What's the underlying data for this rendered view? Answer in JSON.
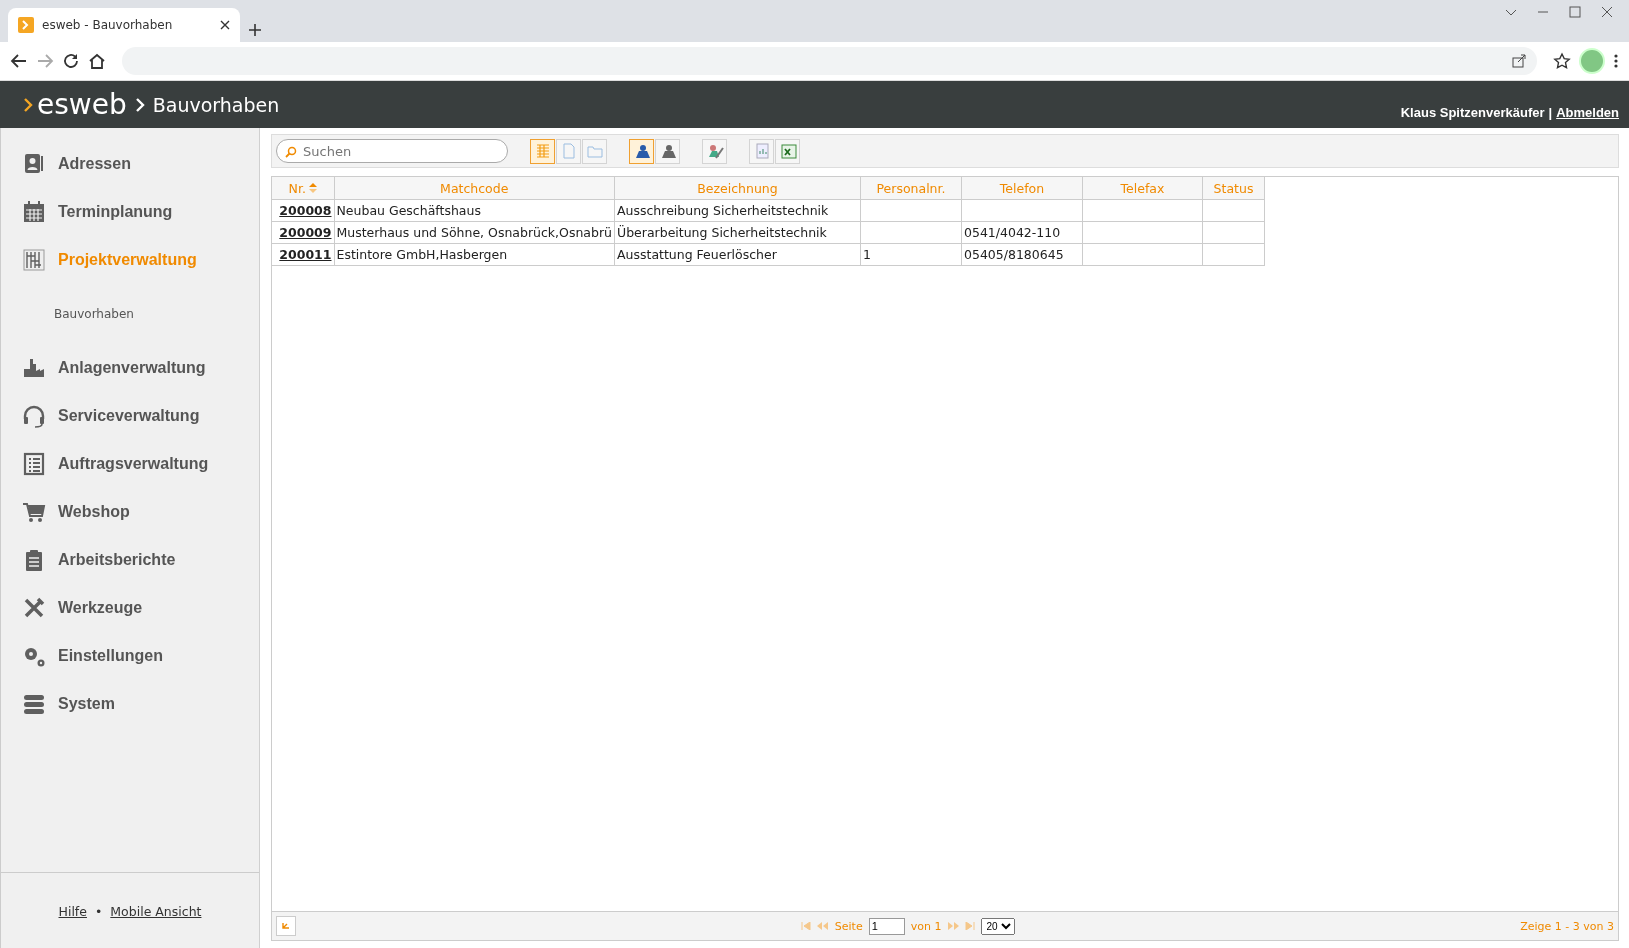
{
  "browser": {
    "tab_title": "esweb - Bauvorhaben"
  },
  "header": {
    "logo": "esweb",
    "breadcrumb": "Bauvorhaben",
    "user": "Klaus Spitzenverkäufer",
    "separator": "|",
    "logout": "Abmelden"
  },
  "sidebar": {
    "items": [
      {
        "label": "Adressen",
        "selected": false
      },
      {
        "label": "Terminplanung",
        "selected": false
      },
      {
        "label": "Projektverwaltung",
        "selected": true,
        "children": [
          {
            "label": "Bauvorhaben",
            "selected": false
          }
        ]
      },
      {
        "label": "Anlagenverwaltung",
        "selected": false
      },
      {
        "label": "Serviceverwaltung",
        "selected": false
      },
      {
        "label": "Auftragsverwaltung",
        "selected": false
      },
      {
        "label": "Webshop",
        "selected": false
      },
      {
        "label": "Arbeitsberichte",
        "selected": false
      },
      {
        "label": "Werkzeuge",
        "selected": false
      },
      {
        "label": "Einstellungen",
        "selected": false
      },
      {
        "label": "System",
        "selected": false
      }
    ],
    "footer_links": [
      "Hilfe",
      "Mobile Ansicht"
    ],
    "footer_separator": "•"
  },
  "toolbar": {
    "search": {
      "placeholder": "Suchen"
    },
    "groups": [
      [
        {
          "selected": true
        },
        {
          "selected": false
        },
        {
          "selected": false
        }
      ],
      [
        {
          "selected": true
        },
        {
          "selected": false
        }
      ],
      [
        {
          "selected": false
        }
      ],
      [
        {
          "selected": false
        },
        {
          "selected": false
        }
      ]
    ]
  },
  "table": {
    "columns": [
      {
        "label": "Nr.",
        "sorted": true
      },
      {
        "label": "Matchcode",
        "sorted": false
      },
      {
        "label": "Bezeichnung",
        "sorted": false
      },
      {
        "label": "Personalnr.",
        "sorted": false
      },
      {
        "label": "Telefon",
        "sorted": false
      },
      {
        "label": "Telefax",
        "sorted": false
      },
      {
        "label": "Status",
        "sorted": false
      }
    ],
    "rows": [
      [
        "200008",
        "Neubau Geschäftshaus",
        "Ausschreibung Sicherheitstechnik",
        "",
        "",
        "",
        ""
      ],
      [
        "200009",
        "Musterhaus und Söhne, Osnabrück,Osnabrü",
        "Überarbeitung Sicherheitstechnik",
        "",
        "0541/4042-110",
        "",
        ""
      ],
      [
        "200011",
        "Estintore GmbH,Hasbergen",
        "Ausstattung Feuerlöscher",
        "1",
        "05405/8180645",
        "",
        ""
      ]
    ]
  },
  "pager": {
    "page_label": "Seite",
    "page": "1",
    "of": "von 1",
    "page_size": "20",
    "summary": "Zeige 1 - 3 von 3"
  }
}
